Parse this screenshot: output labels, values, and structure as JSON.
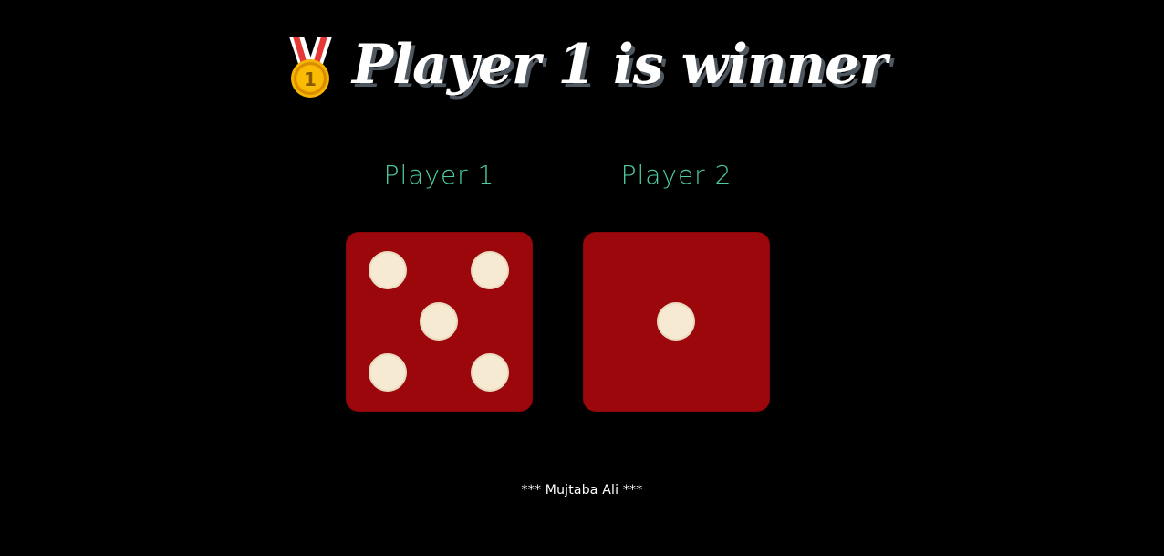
{
  "header": {
    "title": "Player 1 is winner",
    "medal_icon": "first-place-medal-icon"
  },
  "players": [
    {
      "label": "Player 1",
      "dice_value": 5
    },
    {
      "label": "Player 2",
      "dice_value": 1
    }
  ],
  "footer": {
    "credit": "*** Mujtaba Ali ***"
  },
  "colors": {
    "background": "#000000",
    "title_text": "#ffffff",
    "title_shadow": "#4f5760",
    "player_label": "#4ecca3",
    "die_body": "#9b070b",
    "die_pip": "#f6ead3",
    "medal_gold": "#f4b400",
    "medal_ribbon_red": "#e53935",
    "medal_ribbon_white": "#ffffff"
  }
}
